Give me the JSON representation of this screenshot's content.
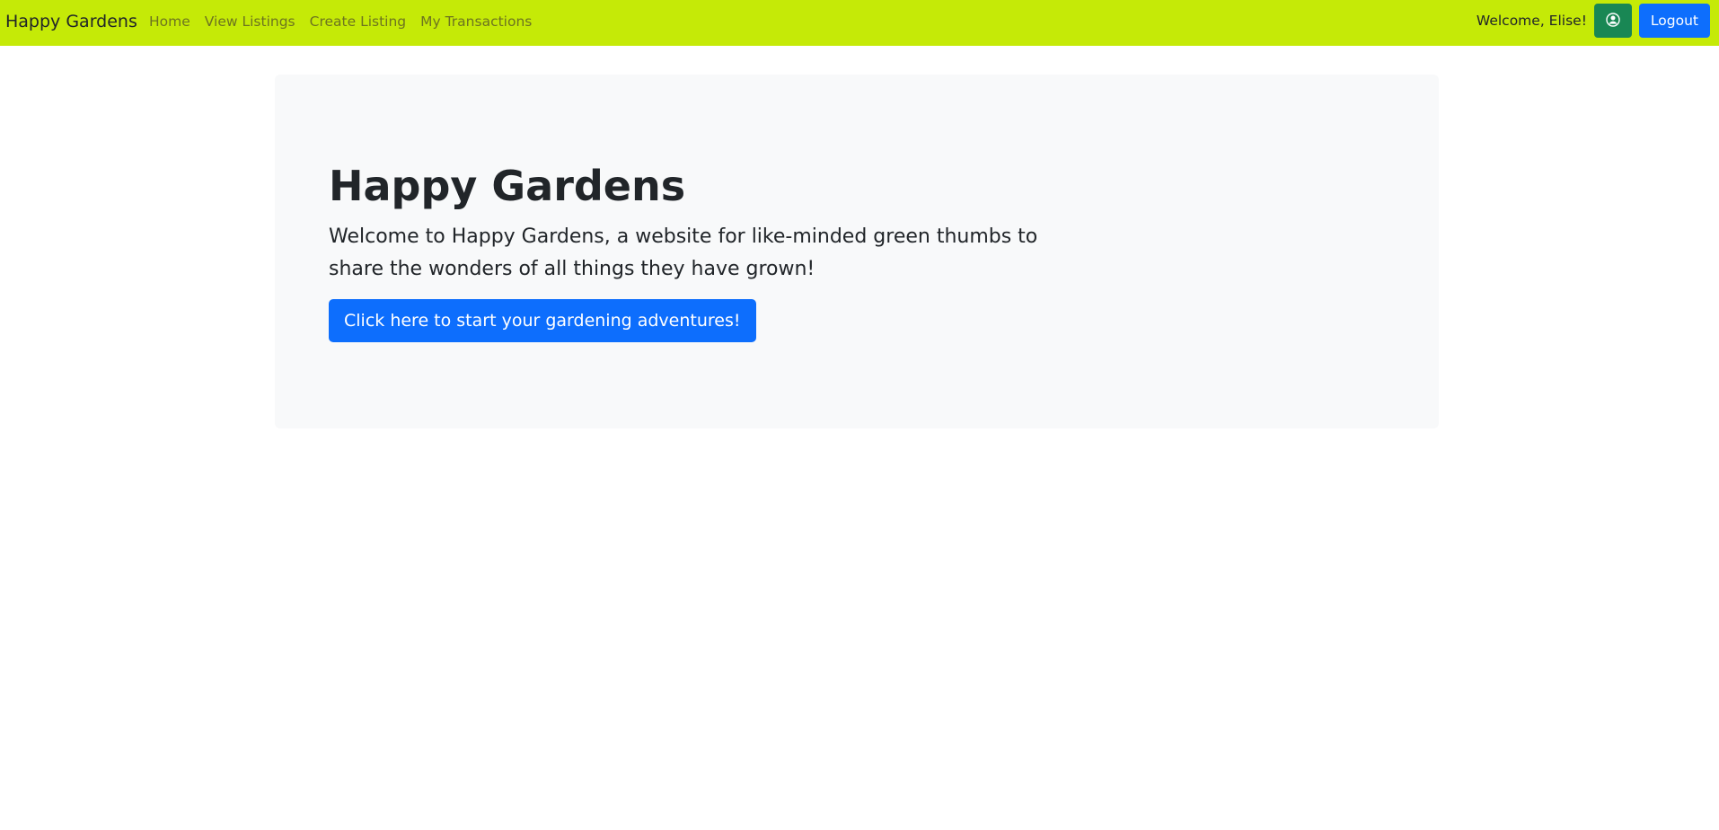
{
  "navbar": {
    "brand": "Happy Gardens",
    "links": [
      "Home",
      "View Listings",
      "Create Listing",
      "My Transactions"
    ],
    "welcome_text": "Welcome, Elise!",
    "profile_icon": "user-circle-icon",
    "logout_label": "Logout",
    "background_color": "#c5ea07"
  },
  "hero": {
    "title": "Happy Gardens",
    "lead": "Welcome to Happy Gardens, a website for like-minded green thumbs to share the wonders of all things they have grown!",
    "button_label": "Click here to start your gardening adventures!"
  },
  "colors": {
    "primary": "#0d6efd",
    "success": "#198754",
    "hero_background": "#f8f9fa"
  }
}
